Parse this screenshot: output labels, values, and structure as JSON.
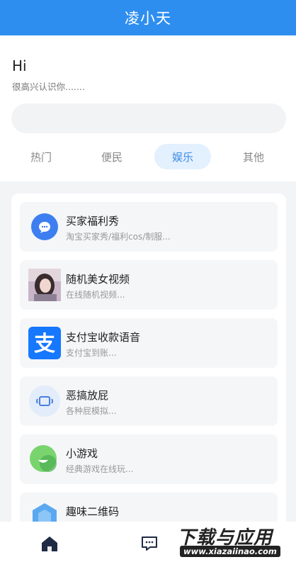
{
  "header": {
    "title": "凌小天"
  },
  "greeting": {
    "hi": "Hi",
    "subtitle": "很高兴认识你......."
  },
  "search": {
    "placeholder": ""
  },
  "tabs": [
    {
      "label": "热门",
      "active": false
    },
    {
      "label": "便民",
      "active": false
    },
    {
      "label": "娱乐",
      "active": true
    },
    {
      "label": "其他",
      "active": false
    }
  ],
  "cards": [
    {
      "title": "买家福利秀",
      "desc": "淘宝买家秀/福利cos/制服...",
      "icon": "chat-bubble-icon"
    },
    {
      "title": "随机美女视频",
      "desc": "在线随机视频...",
      "icon": "portrait-photo-icon"
    },
    {
      "title": "支付宝收款语音",
      "desc": "支付宝到账...",
      "icon": "alipay-icon"
    },
    {
      "title": "恶搞放屁",
      "desc": "各种屁模拟...",
      "icon": "speaker-icon"
    },
    {
      "title": "小游戏",
      "desc": "经典游戏在线玩...",
      "icon": "game-face-icon"
    },
    {
      "title": "趣味二维码",
      "desc": "",
      "icon": "hexagon-icon"
    }
  ],
  "watermark": {
    "main": "下载与应用",
    "url": "www.xiazaiinao.com"
  },
  "colors": {
    "primary": "#2e8ef0",
    "tab_active_bg": "#e3f0fd",
    "alipay": "#1677ff"
  }
}
